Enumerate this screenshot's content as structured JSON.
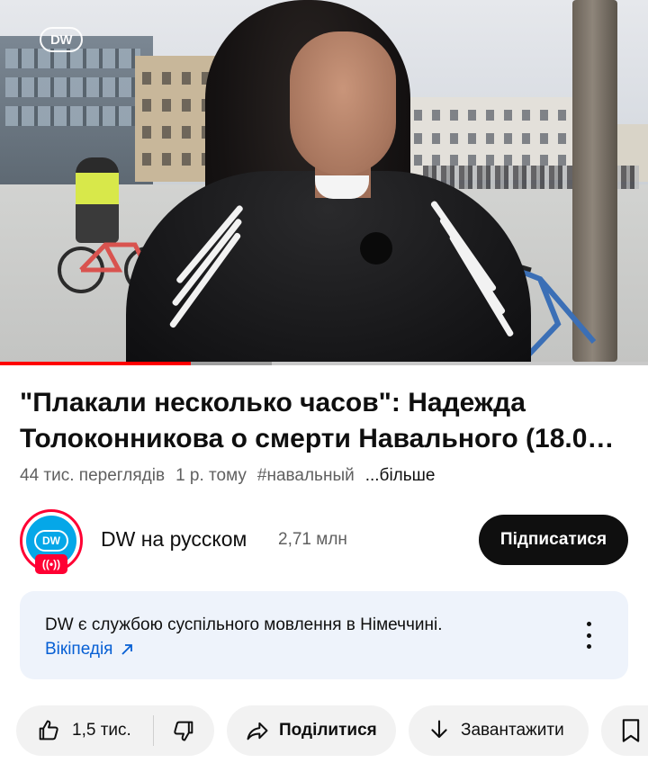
{
  "video": {
    "watermark": "DW",
    "progress_fraction": 0.295,
    "buffer_fraction": 0.42
  },
  "title": {
    "line1": "\"Плакали несколько часов\": Надежда",
    "line2": "Толоконникова о смерти Навального (18.0…"
  },
  "meta": {
    "views": "44 тис. переглядів",
    "age": "1 р. тому",
    "hashtag": "#навальный",
    "more": "...більше"
  },
  "channel": {
    "avatar_text": "DW",
    "live_icon": "((•))",
    "name": "DW на русском",
    "subscribers": "2,71 млн",
    "subscribe_label": "Підписатися"
  },
  "info": {
    "text": "DW є службою суспільного мовлення в Німеччині.",
    "link_label": "Вікіпедія"
  },
  "actions": {
    "like_count": "1,5 тис.",
    "share_label": "Поділитися",
    "download_label": "Завантажити"
  },
  "colors": {
    "progress_red": "#ff0000",
    "link_blue": "#065fd4",
    "subscribe_bg": "#0f0f0f",
    "dw_blue": "#05a7e8",
    "live_red": "#ff0033",
    "info_bg": "#eef3fb",
    "chip_bg": "#f2f2f2"
  },
  "icons": [
    "thumbs-up-icon",
    "thumbs-down-icon",
    "share-icon",
    "download-icon",
    "save-icon",
    "more-vert-icon",
    "external-link-icon",
    "live-broadcast-icon"
  ]
}
